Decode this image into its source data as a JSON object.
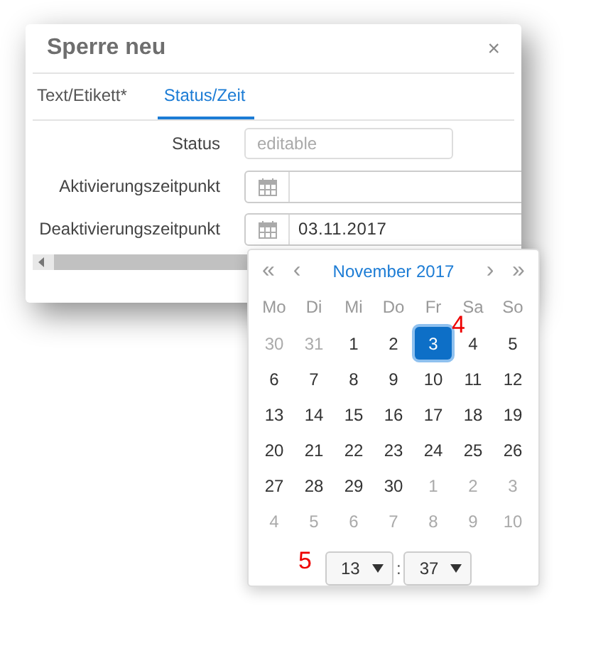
{
  "dialog": {
    "title": "Sperre neu",
    "close": "×"
  },
  "tabs": [
    {
      "label": "Text/Etikett*",
      "selected": false
    },
    {
      "label": "Status/Zeit",
      "selected": true
    }
  ],
  "fields": [
    {
      "label": "Status",
      "kind": "text",
      "placeholder": "editable"
    },
    {
      "label": "Aktivierungszeitpunkt",
      "kind": "date"
    },
    {
      "label": "Deaktivierungszeitpunkt",
      "kind": "date",
      "value": "03.11.2017"
    }
  ],
  "calendar": {
    "nav": [
      "«",
      "‹",
      "›",
      "»"
    ],
    "month": "November 2017",
    "weekdays": [
      "Mo",
      "Di",
      "Mi",
      "Do",
      "Fr",
      "Sa",
      "So"
    ],
    "weeks": [
      [
        {
          "label": "30",
          "other_month": true,
          "selected": false
        },
        {
          "label": "31",
          "other_month": true,
          "selected": false
        },
        {
          "label": "1",
          "other_month": false,
          "selected": false
        },
        {
          "label": "2",
          "other_month": false,
          "selected": false
        },
        {
          "label": "3",
          "other_month": false,
          "selected": true
        },
        {
          "label": "4",
          "other_month": false,
          "selected": false
        },
        {
          "label": "5",
          "other_month": false,
          "selected": false
        }
      ],
      [
        {
          "label": "6",
          "other_month": false,
          "selected": false
        },
        {
          "label": "7",
          "other_month": false,
          "selected": false
        },
        {
          "label": "8",
          "other_month": false,
          "selected": false
        },
        {
          "label": "9",
          "other_month": false,
          "selected": false
        },
        {
          "label": "10",
          "other_month": false,
          "selected": false
        },
        {
          "label": "11",
          "other_month": false,
          "selected": false
        },
        {
          "label": "12",
          "other_month": false,
          "selected": false
        }
      ],
      [
        {
          "label": "13",
          "other_month": false,
          "selected": false
        },
        {
          "label": "14",
          "other_month": false,
          "selected": false
        },
        {
          "label": "15",
          "other_month": false,
          "selected": false
        },
        {
          "label": "16",
          "other_month": false,
          "selected": false
        },
        {
          "label": "17",
          "other_month": false,
          "selected": false
        },
        {
          "label": "18",
          "other_month": false,
          "selected": false
        },
        {
          "label": "19",
          "other_month": false,
          "selected": false
        }
      ],
      [
        {
          "label": "20",
          "other_month": false,
          "selected": false
        },
        {
          "label": "21",
          "other_month": false,
          "selected": false
        },
        {
          "label": "22",
          "other_month": false,
          "selected": false
        },
        {
          "label": "23",
          "other_month": false,
          "selected": false
        },
        {
          "label": "24",
          "other_month": false,
          "selected": false
        },
        {
          "label": "25",
          "other_month": false,
          "selected": false
        },
        {
          "label": "26",
          "other_month": false,
          "selected": false
        }
      ],
      [
        {
          "label": "27",
          "other_month": false,
          "selected": false
        },
        {
          "label": "28",
          "other_month": false,
          "selected": false
        },
        {
          "label": "29",
          "other_month": false,
          "selected": false
        },
        {
          "label": "30",
          "other_month": false,
          "selected": false
        },
        {
          "label": "1",
          "other_month": true,
          "selected": false
        },
        {
          "label": "2",
          "other_month": true,
          "selected": false
        },
        {
          "label": "3",
          "other_month": true,
          "selected": false
        }
      ],
      [
        {
          "label": "4",
          "other_month": true,
          "selected": false
        },
        {
          "label": "5",
          "other_month": true,
          "selected": false
        },
        {
          "label": "6",
          "other_month": true,
          "selected": false
        },
        {
          "label": "7",
          "other_month": true,
          "selected": false
        },
        {
          "label": "8",
          "other_month": true,
          "selected": false
        },
        {
          "label": "9",
          "other_month": true,
          "selected": false
        },
        {
          "label": "10",
          "other_month": true,
          "selected": false
        }
      ]
    ],
    "hour": "13",
    "separator": ":",
    "minute": "37"
  },
  "annotations": [
    "4",
    "5"
  ]
}
